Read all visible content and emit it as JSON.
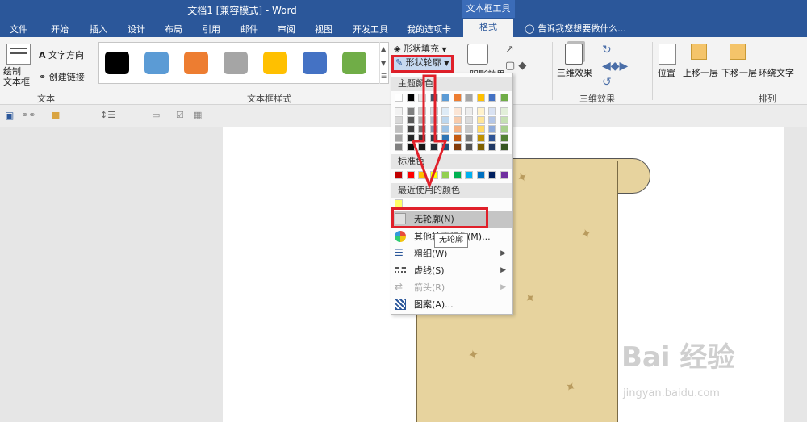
{
  "window": {
    "title": "文档1 [兼容模式] - Word",
    "context_tab_group": "文本框工具"
  },
  "tabs": [
    "文件",
    "开始",
    "插入",
    "设计",
    "布局",
    "引用",
    "邮件",
    "审阅",
    "视图",
    "开发工具",
    "我的选项卡",
    "格式"
  ],
  "tell_me": "告诉我您想要做什么...",
  "ribbon": {
    "draw_textbox": "绘制\n文本框",
    "text_direction": "文字方向",
    "create_link": "创建链接",
    "group_text": "文本",
    "group_textbox_styles": "文本框样式",
    "shape_fill": "形状填充",
    "shape_outline": "形状轮廓",
    "shadow_effect": "阴影效果",
    "three_d_effect": "三维效果",
    "group_three_d_effect": "三维效果",
    "position": "位置",
    "bring_forward": "上移一层",
    "send_backward": "下移一层",
    "wrap_text": "环绕文字",
    "group_arrange": "排列",
    "style_colors": [
      "#000000",
      "#5b9bd5",
      "#ed7d31",
      "#a5a5a5",
      "#ffc000",
      "#4472c4",
      "#70ad47"
    ]
  },
  "dropdown": {
    "theme_colors": "主题颜色",
    "standard_colors": "标准色",
    "recent_colors": "最近使用的颜色",
    "no_outline": "无轮廓(N)",
    "more_colors": "其他轮廓颜色(M)...",
    "weight": "粗细(W)",
    "dashes": "虚线(S)",
    "arrows": "箭头(R)",
    "pattern": "图案(A)...",
    "tooltip": "无轮廓",
    "theme_row": [
      "#ffffff",
      "#000000",
      "#e7e6e6",
      "#44546a",
      "#5b9bd5",
      "#ed7d31",
      "#a5a5a5",
      "#ffc000",
      "#4472c4",
      "#70ad47"
    ],
    "theme_shades": [
      [
        "#f2f2f2",
        "#7f7f7f",
        "#d0cece",
        "#d6dce4",
        "#deebf6",
        "#fbe5d5",
        "#ededed",
        "#fff2cc",
        "#d9e2f3",
        "#e2efd9"
      ],
      [
        "#d8d8d8",
        "#595959",
        "#aeabab",
        "#adb9ca",
        "#bdd7ee",
        "#f7cbac",
        "#dbdbdb",
        "#fee599",
        "#b4c6e7",
        "#c5e0b3"
      ],
      [
        "#bfbfbf",
        "#3f3f3f",
        "#757070",
        "#8496b0",
        "#9dc3e6",
        "#f4b183",
        "#c9c9c9",
        "#ffd965",
        "#8eaadb",
        "#a8d08d"
      ],
      [
        "#a5a5a5",
        "#262626",
        "#3a3838",
        "#323f4f",
        "#2e75b5",
        "#c55a11",
        "#7b7b7b",
        "#bf9000",
        "#2f5496",
        "#538135"
      ],
      [
        "#7f7f7f",
        "#0c0c0c",
        "#171616",
        "#222a35",
        "#1e4e79",
        "#843c0c",
        "#525252",
        "#7f6000",
        "#1f3864",
        "#375623"
      ]
    ],
    "standard_row": [
      "#c00000",
      "#ff0000",
      "#ffc000",
      "#ffff00",
      "#92d050",
      "#00b050",
      "#00b0f0",
      "#0070c0",
      "#002060",
      "#7030a0"
    ],
    "recent_row": [
      "#ffff66"
    ]
  },
  "watermark": {
    "brand": "Bai 经验",
    "url": "jingyan.baidu.com"
  }
}
